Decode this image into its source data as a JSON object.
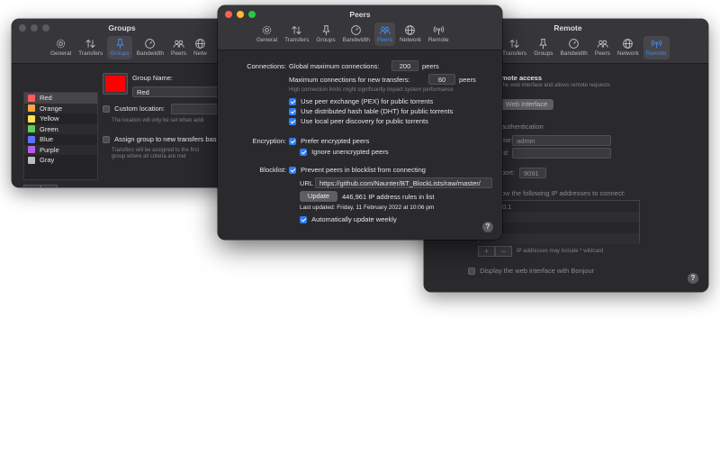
{
  "windows": {
    "groups": {
      "title": "Groups",
      "toolbar": [
        {
          "label": "General",
          "icon": "gear-icon"
        },
        {
          "label": "Transfers",
          "icon": "transfers-arrows-icon"
        },
        {
          "label": "Groups",
          "icon": "push-pin-icon",
          "selected": true
        },
        {
          "label": "Bandwidth",
          "icon": "speedometer-icon"
        },
        {
          "label": "Peers",
          "icon": "people-icon"
        },
        {
          "label": "Netw",
          "icon": "globe-icon"
        }
      ],
      "groups": [
        {
          "name": "Red",
          "color": "#ff5b5b"
        },
        {
          "name": "Orange",
          "color": "#ffa53d"
        },
        {
          "name": "Yellow",
          "color": "#ffe34a"
        },
        {
          "name": "Green",
          "color": "#5ad05a"
        },
        {
          "name": "Blue",
          "color": "#5b74ff"
        },
        {
          "name": "Purple",
          "color": "#b55de6"
        },
        {
          "name": "Gray",
          "color": "#bdbdbd"
        }
      ],
      "selected_color": "#ff0000",
      "group_name_label": "Group Name:",
      "group_name_value": "Red",
      "custom_location_label": "Custom location:",
      "custom_location_hint": "The location will only be set when addi",
      "assign_label": "Assign group to new transfers bas",
      "assign_hint_1": "Transfers will be assigned to the first",
      "assign_hint_2": "group where all criteria are met",
      "add_label": "+",
      "remove_label": "−"
    },
    "peers": {
      "title": "Peers",
      "toolbar": [
        {
          "label": "General",
          "icon": "gear-icon"
        },
        {
          "label": "Transfers",
          "icon": "transfers-arrows-icon"
        },
        {
          "label": "Groups",
          "icon": "push-pin-icon"
        },
        {
          "label": "Bandwidth",
          "icon": "speedometer-icon"
        },
        {
          "label": "Peers",
          "icon": "people-icon",
          "selected": true
        },
        {
          "label": "Network",
          "icon": "globe-icon"
        },
        {
          "label": "Remote",
          "icon": "antenna-icon"
        }
      ],
      "connections_label": "Connections:",
      "global_max_label": "Global maximum connections:",
      "global_max_value": "200",
      "peers_unit": "peers",
      "max_new_label": "Maximum connections for new transfers:",
      "max_new_value": "60",
      "limit_note": "High connection limits might significantly impact system performance",
      "pex_label": "Use peer exchange (PEX) for public torrents",
      "dht_label": "Use distributed hash table (DHT) for public torrents",
      "lpd_label": "Use local peer discovery for public torrents",
      "encryption_label": "Encryption:",
      "prefer_encrypted_label": "Prefer encrypted peers",
      "ignore_unencrypted_label": "Ignore unencrypted peers",
      "blocklist_label": "Blocklist:",
      "blocklist_enable_label": "Prevent peers in blocklist from connecting",
      "url_label": "URL",
      "url_value": "https://github.com/Naunter/BT_BlockLists/raw/master/",
      "update_button": "Update",
      "rules_count": "446,961 IP address rules in list",
      "last_updated": "Last updated: Friday, 11 February 2022 at 10:06 pm",
      "auto_update_label": "Automatically update weekly",
      "help": "?"
    },
    "remote": {
      "title": "Remote",
      "toolbar": [
        {
          "label": "Transfers",
          "icon": "transfers-arrows-icon"
        },
        {
          "label": "Groups",
          "icon": "push-pin-icon"
        },
        {
          "label": "Bandwidth",
          "icon": "speedometer-icon"
        },
        {
          "label": "Peers",
          "icon": "people-icon"
        },
        {
          "label": "Network",
          "icon": "globe-icon"
        },
        {
          "label": "Remote",
          "icon": "antenna-icon",
          "selected": true
        }
      ],
      "remote_access": "mote access",
      "remote_access_note": "the web interface and allows remote requests",
      "open_web_button": "Web Interface",
      "auth_label": "authentication",
      "username_label": "me:",
      "username_value": "admin",
      "password_label": "rd:",
      "port_label": "port:",
      "port_value": "9091",
      "allow_ips_label": "ow the following IP addresses to connect:",
      "ip_entry": "0.1",
      "add_label": "+",
      "remove_label": "−",
      "wildcard_note": "IP addresses may include * wildcard",
      "bonjour_label": "Display the web interface with Bonjour",
      "help": "?"
    }
  }
}
